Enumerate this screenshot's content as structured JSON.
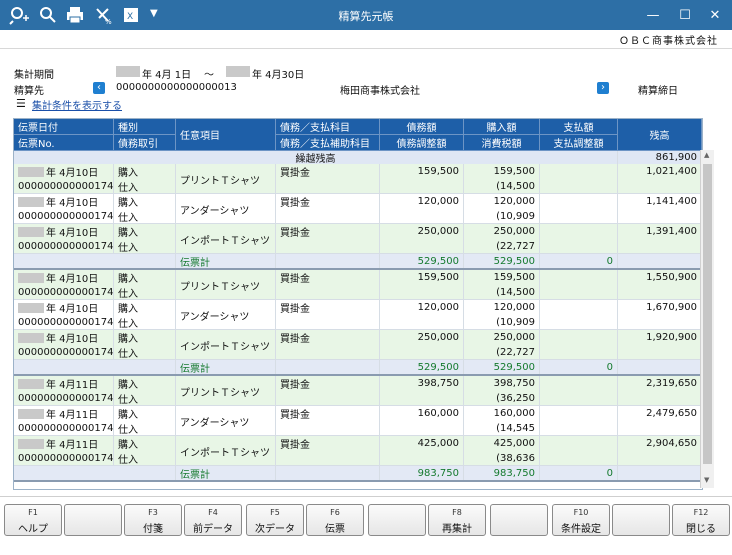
{
  "window": {
    "title": "精算先元帳"
  },
  "company": "ＯＢＣ商事株式会社",
  "conditions": {
    "period_label": "集計期間",
    "period_start": "年  4月  1日",
    "period_sep": "～",
    "period_end": "年  4月30日",
    "partner_label": "精算先",
    "partner_code": "0000000000000000013",
    "partner_name": "梅田商事株式会社",
    "closing_label": "精算締日",
    "show_link": "集計条件を表示する"
  },
  "headers": {
    "date": "伝票日付",
    "slip": "伝票No.",
    "kind": "種別",
    "kind2": "債務取引",
    "item": "任意項目",
    "acct": "債務／支払科目",
    "acct2": "債務／支払補助科目",
    "debt": "債務額",
    "debt2": "債務調整額",
    "purchase": "購入額",
    "purchase2": "消費税額",
    "pay": "支払額",
    "pay2": "支払調整額",
    "balance": "残高"
  },
  "carry": {
    "label": "繰越残高",
    "balance": "861,900"
  },
  "groups": [
    {
      "rows": [
        {
          "date": "年  4月10日",
          "slip": "000000000000174",
          "kind": "購入",
          "kind2": "仕入",
          "item": "プリントＴシャツ",
          "acct": "買掛金",
          "debt": "159,500",
          "purchase": "159,500",
          "tax": "(14,500",
          "balance": "1,021,400"
        },
        {
          "date": "年  4月10日",
          "slip": "000000000000174",
          "kind": "購入",
          "kind2": "仕入",
          "item": "アンダーシャツ",
          "acct": "買掛金",
          "debt": "120,000",
          "purchase": "120,000",
          "tax": "(10,909",
          "balance": "1,141,400"
        },
        {
          "date": "年  4月10日",
          "slip": "000000000000174",
          "kind": "購入",
          "kind2": "仕入",
          "item": "インポートＴシャツ",
          "acct": "買掛金",
          "debt": "250,000",
          "purchase": "250,000",
          "tax": "(22,727",
          "balance": "1,391,400"
        }
      ],
      "subtotal": {
        "label": "伝票計",
        "debt": "529,500",
        "purchase": "529,500",
        "pay": "0"
      }
    },
    {
      "rows": [
        {
          "date": "年  4月10日",
          "slip": "000000000000174",
          "kind": "購入",
          "kind2": "仕入",
          "item": "プリントＴシャツ",
          "acct": "買掛金",
          "debt": "159,500",
          "purchase": "159,500",
          "tax": "(14,500",
          "balance": "1,550,900"
        },
        {
          "date": "年  4月10日",
          "slip": "000000000000174",
          "kind": "購入",
          "kind2": "仕入",
          "item": "アンダーシャツ",
          "acct": "買掛金",
          "debt": "120,000",
          "purchase": "120,000",
          "tax": "(10,909",
          "balance": "1,670,900"
        },
        {
          "date": "年  4月10日",
          "slip": "000000000000174",
          "kind": "購入",
          "kind2": "仕入",
          "item": "インポートＴシャツ",
          "acct": "買掛金",
          "debt": "250,000",
          "purchase": "250,000",
          "tax": "(22,727",
          "balance": "1,920,900"
        }
      ],
      "subtotal": {
        "label": "伝票計",
        "debt": "529,500",
        "purchase": "529,500",
        "pay": "0"
      }
    },
    {
      "rows": [
        {
          "date": "年  4月11日",
          "slip": "000000000000174",
          "kind": "購入",
          "kind2": "仕入",
          "item": "プリントＴシャツ",
          "acct": "買掛金",
          "debt": "398,750",
          "purchase": "398,750",
          "tax": "(36,250",
          "balance": "2,319,650"
        },
        {
          "date": "年  4月11日",
          "slip": "000000000000174",
          "kind": "購入",
          "kind2": "仕入",
          "item": "アンダーシャツ",
          "acct": "買掛金",
          "debt": "160,000",
          "purchase": "160,000",
          "tax": "(14,545",
          "balance": "2,479,650"
        },
        {
          "date": "年  4月11日",
          "slip": "000000000000174",
          "kind": "購入",
          "kind2": "仕入",
          "item": "インポートＴシャツ",
          "acct": "買掛金",
          "debt": "425,000",
          "purchase": "425,000",
          "tax": "(38,636",
          "balance": "2,904,650"
        }
      ],
      "subtotal": {
        "label": "伝票計",
        "debt": "983,750",
        "purchase": "983,750",
        "pay": "0"
      }
    }
  ],
  "fkeys": [
    {
      "key": "F1",
      "label": "ヘルプ"
    },
    {
      "key": "",
      "label": ""
    },
    {
      "key": "F3",
      "label": "付箋"
    },
    {
      "key": "F4",
      "label": "前データ"
    },
    {
      "key": "F5",
      "label": "次データ"
    },
    {
      "key": "F6",
      "label": "伝票"
    },
    {
      "key": "",
      "label": ""
    },
    {
      "key": "F8",
      "label": "再集計"
    },
    {
      "key": "",
      "label": ""
    },
    {
      "key": "F10",
      "label": "条件設定"
    },
    {
      "key": "",
      "label": ""
    },
    {
      "key": "F12",
      "label": "閉じる"
    }
  ]
}
